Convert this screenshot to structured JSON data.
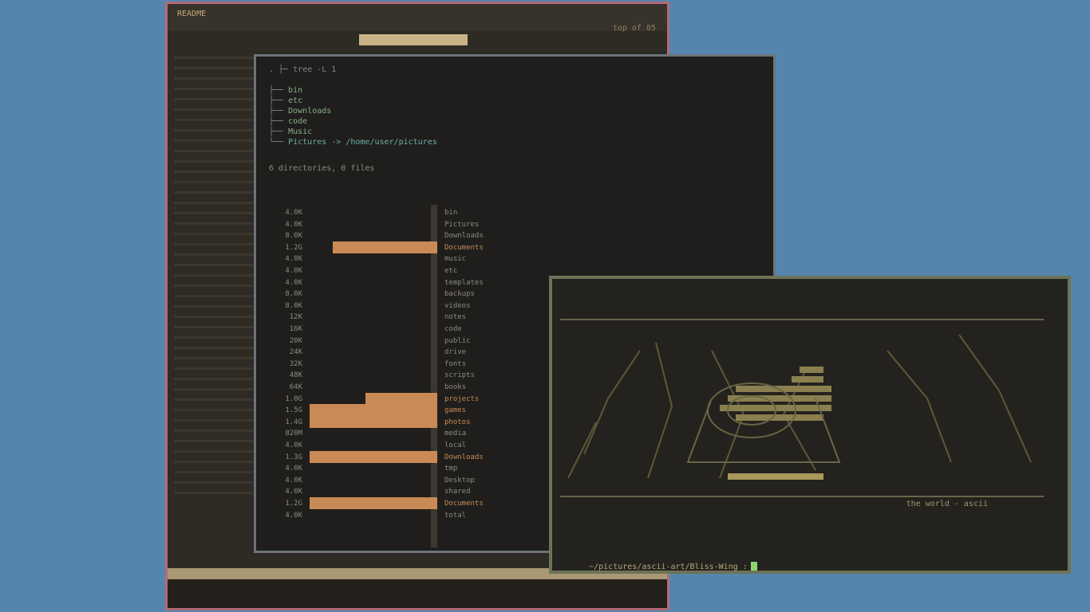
{
  "colors": {
    "desktop": "#5585ad",
    "editor_border": "#b36a78",
    "bar_accent": "#c98a55",
    "bar_highlight": "#e8c98e",
    "cursor": "#8fd66e"
  },
  "editor": {
    "title": "README",
    "position": "top of 85",
    "status": "",
    "command_line": ""
  },
  "tree": {
    "header": ". ├─ tree -L 1",
    "items": [
      {
        "name": "bin",
        "kind": "dir"
      },
      {
        "name": "etc",
        "kind": "dir"
      },
      {
        "name": "Downloads",
        "kind": "dir"
      },
      {
        "name": "code",
        "kind": "dir"
      },
      {
        "name": "Music",
        "kind": "dir"
      },
      {
        "name": "Pictures -> /home/user/pictures",
        "kind": "link"
      }
    ],
    "summary": "6 directories, 0 files"
  },
  "usage_chart": {
    "rows": [
      {
        "size": "4.0K",
        "name": "bin",
        "fill": 0
      },
      {
        "size": "4.0K",
        "name": "Pictures",
        "fill": 0
      },
      {
        "size": "8.0K",
        "name": "Downloads",
        "fill": 0
      },
      {
        "size": "1.2G",
        "name": "Documents",
        "fill": 0.82
      },
      {
        "size": "4.0K",
        "name": "music",
        "fill": 0
      },
      {
        "size": "4.0K",
        "name": "etc",
        "fill": 0
      },
      {
        "size": "4.0K",
        "name": "templates",
        "fill": 0
      },
      {
        "size": "8.0K",
        "name": "backups",
        "fill": 0
      },
      {
        "size": "8.0K",
        "name": "videos",
        "fill": 0
      },
      {
        "size": "12K",
        "name": "notes",
        "fill": 0
      },
      {
        "size": "16K",
        "name": "code",
        "fill": 0
      },
      {
        "size": "20K",
        "name": "public",
        "fill": 0
      },
      {
        "size": "24K",
        "name": "drive",
        "fill": 0
      },
      {
        "size": "32K",
        "name": "fonts",
        "fill": 0
      },
      {
        "size": "48K",
        "name": "scripts",
        "fill": 0
      },
      {
        "size": "64K",
        "name": "books",
        "fill": 0
      },
      {
        "size": "1.0G",
        "name": "projects",
        "fill": 0.56
      },
      {
        "size": "1.5G",
        "name": "games",
        "fill": 1.0
      },
      {
        "size": "1.4G",
        "name": "photos",
        "fill": 1.0
      },
      {
        "size": "820M",
        "name": "media",
        "fill": 0
      },
      {
        "size": "4.0K",
        "name": "local",
        "fill": 0
      },
      {
        "size": "1.3G",
        "name": "Downloads",
        "fill": 1.0
      },
      {
        "size": "4.0K",
        "name": "tmp",
        "fill": 0
      },
      {
        "size": "4.0K",
        "name": "Desktop",
        "fill": 0
      },
      {
        "size": "4.0K",
        "name": "shared",
        "fill": 0
      },
      {
        "size": "1.2G",
        "name": "Documents",
        "fill": 1.0
      },
      {
        "size": "4.0K",
        "name": "total",
        "fill": 0
      }
    ]
  },
  "terminal": {
    "caption": "the world - ascii",
    "prompt": "~/pictures/ascii-art/Bliss-Wing :"
  }
}
